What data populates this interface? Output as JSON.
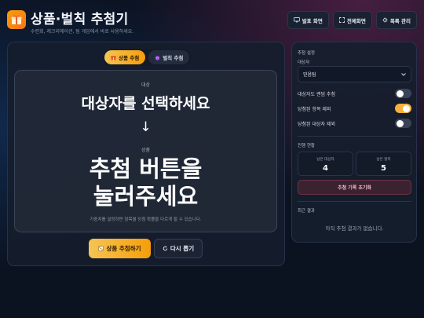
{
  "header": {
    "title": "상품·벌칙 추첨기",
    "subtitle": "수련회, 레크리에이션, 팀 게임에서 바로 사용하세요.",
    "buttons": [
      {
        "label": "발표 화면",
        "icon": "monitor-icon"
      },
      {
        "label": "전체화면",
        "icon": "fullscreen-icon"
      },
      {
        "label": "목록 관리",
        "icon": "gear-icon"
      }
    ]
  },
  "mode_tabs": [
    {
      "label": "상품 추첨",
      "icon": "gift-icon",
      "active": true
    },
    {
      "label": "벌칙 추첨",
      "icon": "devil-icon",
      "active": false
    }
  ],
  "stage": {
    "target_label": "대상",
    "target_text": "대상자를 선택하세요",
    "arrow": "↓",
    "prize_label": "상품",
    "prize_line1": "추첨 버튼을",
    "prize_line2": "눌러주세요",
    "hint": "가중치를 설정하면 항목별 당첨 확률을 다르게 할 수 있습니다."
  },
  "actions": {
    "draw_label": "상품 추첨하기",
    "redraw_label": "다시 뽑기"
  },
  "settings": {
    "heading": "추첨 설정",
    "target_heading": "대상자",
    "target_selected": "믿음팀",
    "toggles": [
      {
        "label": "대상자도 랜덤 추첨",
        "on": false
      },
      {
        "label": "당첨된 항목 제외",
        "on": true
      },
      {
        "label": "당첨된 대상자 제외",
        "on": false
      }
    ]
  },
  "progress": {
    "heading": "진행 현황",
    "remaining_targets_label": "남은 대상자",
    "remaining_targets_value": "4",
    "remaining_items_label": "남은 항목",
    "remaining_items_value": "5",
    "reset_label": "추첨 기록 초기화"
  },
  "results": {
    "heading": "최근 결과",
    "empty_message": "아직 추첨 결과가 없습니다."
  },
  "colors": {
    "accent": "#f5b33d",
    "background": "#0b1220",
    "danger": "#6e3145"
  }
}
